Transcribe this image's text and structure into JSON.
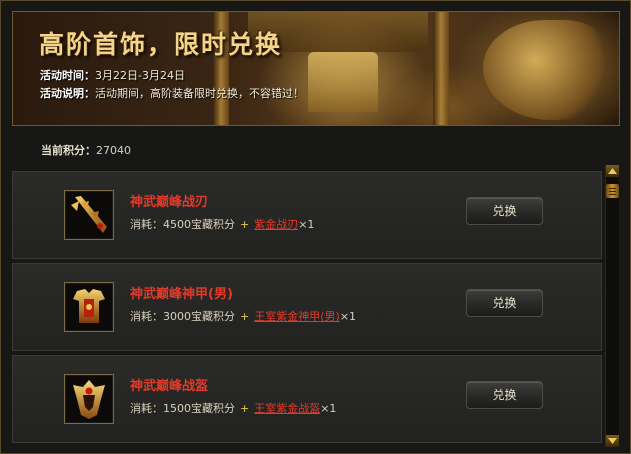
{
  "banner": {
    "title": "高阶首饰，限时兑换",
    "time_label": "活动时间：",
    "time_value": "3月22日-3月24日",
    "desc_label": "活动说明：",
    "desc_value": "活动期间，高阶装备限时兑换，不容错过！"
  },
  "points": {
    "label": "当前积分：",
    "value": "27040"
  },
  "items": [
    {
      "name": "神武巅峰战刃",
      "cost": "消耗：4500宝藏积分",
      "plus": "+",
      "requirement": "紫金战刃",
      "qty": "×1",
      "button": "兑换",
      "icon": "blade-icon"
    },
    {
      "name": "神武巅峰神甲(男)",
      "cost": "消耗：3000宝藏积分",
      "plus": "+",
      "requirement": "王室紫金神甲(男)",
      "qty": "×1",
      "button": "兑换",
      "icon": "armor-icon"
    },
    {
      "name": "神武巅峰战盔",
      "cost": "消耗：1500宝藏积分",
      "plus": "+",
      "requirement": "王室紫金战盔",
      "qty": "×1",
      "button": "兑换",
      "icon": "helmet-icon"
    }
  ],
  "colors": {
    "item_name": "#e23a2a",
    "accent_gold": "#c8962e",
    "plus": "#e8c840"
  }
}
